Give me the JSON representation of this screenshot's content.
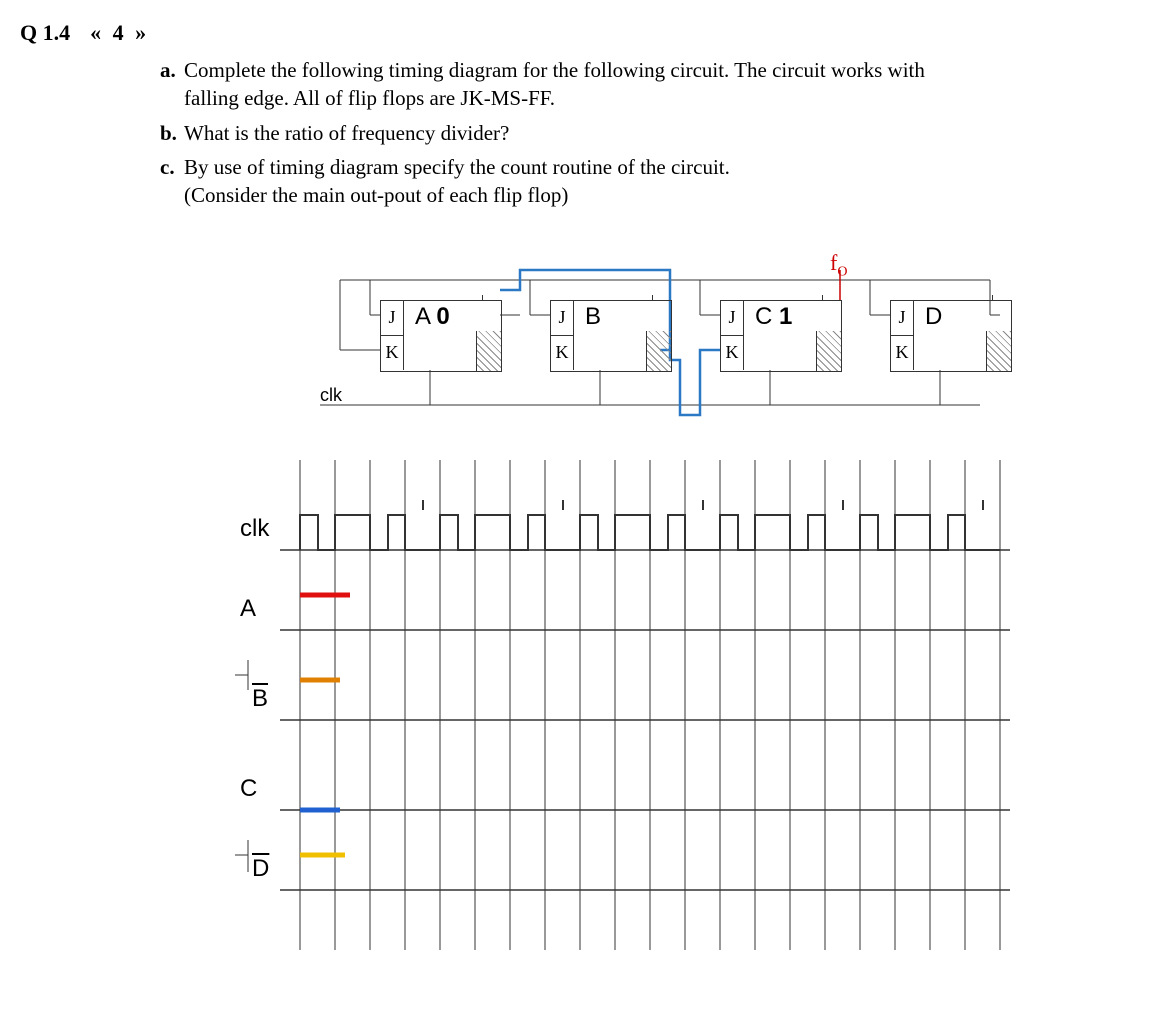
{
  "question": {
    "number": "Q 1.4",
    "nav_prev": "«",
    "nav_num": "4",
    "nav_next": "»",
    "parts": {
      "a": {
        "label": "a.",
        "text1": "Complete the following timing diagram for the following circuit. The circuit works with",
        "text2": "falling edge. All of flip flops are JK-MS-FF."
      },
      "b": {
        "label": "b.",
        "text": "What is the ratio of frequency divider?"
      },
      "c": {
        "label": "c.",
        "text1": "By use of timing diagram specify the count routine of the circuit.",
        "text2": "(Consider the main out-pout of each flip flop)"
      }
    }
  },
  "circuit": {
    "clk_label": "clk",
    "fo_label": "fO",
    "flipflops": [
      {
        "name": "A",
        "suffix": "0",
        "J": "J",
        "K": "K"
      },
      {
        "name": "B",
        "suffix": "",
        "J": "J",
        "K": "K"
      },
      {
        "name": "C",
        "suffix": "1",
        "J": "J",
        "K": "K"
      },
      {
        "name": "D",
        "suffix": "",
        "J": "J",
        "K": "K"
      }
    ]
  },
  "timing": {
    "rows": [
      {
        "label": "clk",
        "bar": false
      },
      {
        "label": "A",
        "bar": false
      },
      {
        "label": "B",
        "bar": true
      },
      {
        "label": "C",
        "bar": false
      },
      {
        "label": "D",
        "bar": true
      }
    ],
    "clk_cycles": 10,
    "initial_segments": {
      "A": {
        "color": "#e01010",
        "level": "high"
      },
      "B_bar": {
        "color": "#e08000",
        "level": "high"
      },
      "C": {
        "color": "#2060d0",
        "level": "low"
      },
      "D_bar": {
        "color": "#f0c000",
        "level": "high"
      }
    }
  }
}
